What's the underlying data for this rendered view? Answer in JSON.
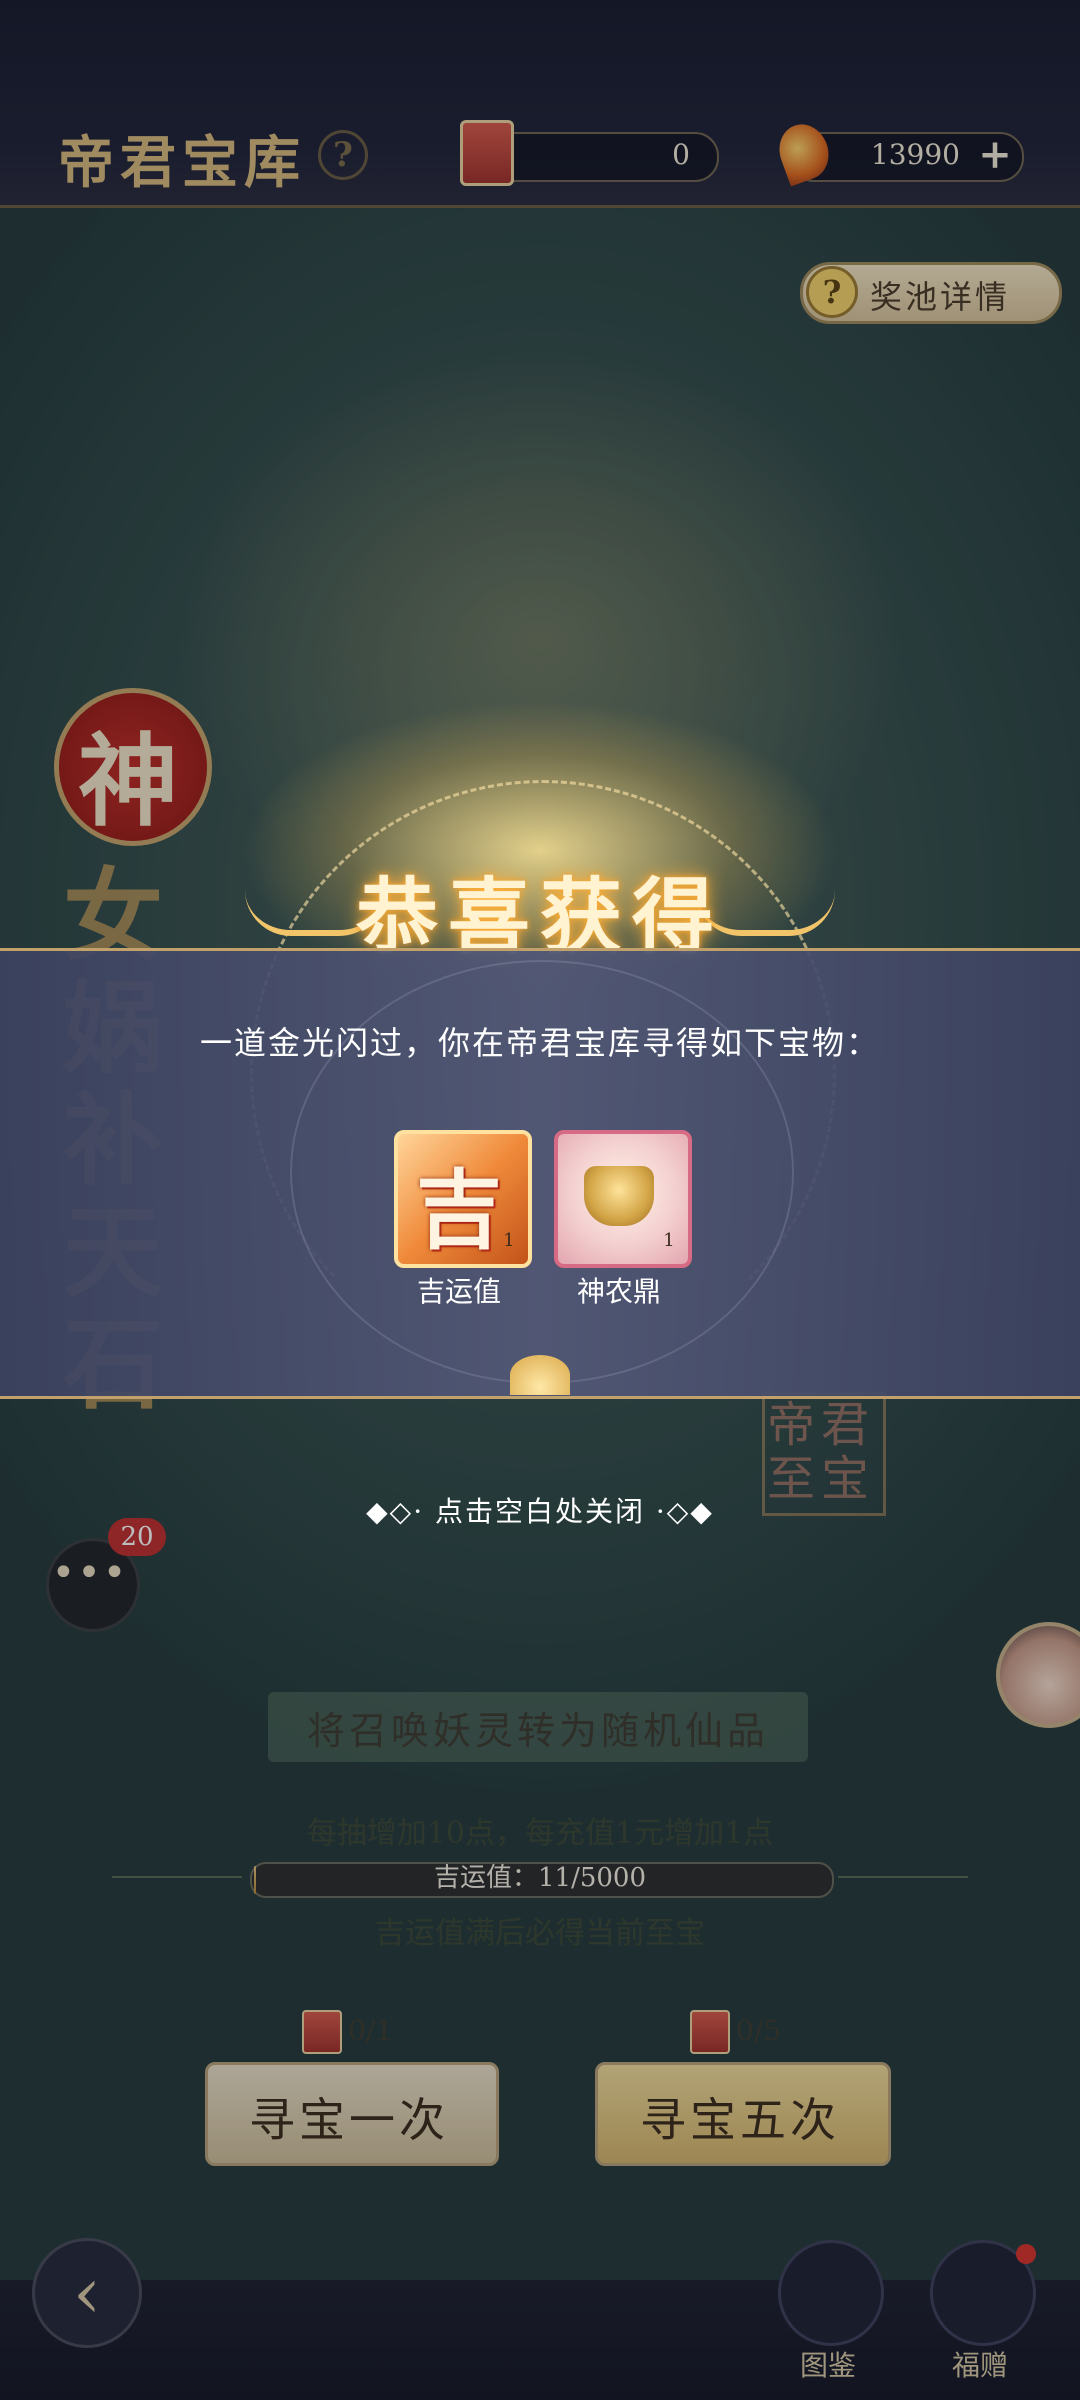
{
  "header": {
    "title": "帝君宝库",
    "help_glyph": "?",
    "currency_ticket": {
      "value": "0"
    },
    "currency_gem": {
      "value": "13990",
      "add_glyph": "+"
    }
  },
  "prize_pool": {
    "help_glyph": "?",
    "label": "奖池详情"
  },
  "side_banner": {
    "seal_char": "神",
    "vertical_title": "女娲补天石"
  },
  "seal": {
    "text": "帝君至宝"
  },
  "chat": {
    "glyph": "•••",
    "badge": "20"
  },
  "info": {
    "title": "将召唤妖灵转为随机仙品",
    "line1": "每抽增加10点，每充值1元增加1点",
    "luck_label": "吉运值：11/5000",
    "luck_progress": 0.0022,
    "note": "吉运值满后必得当前至宝"
  },
  "draw": {
    "once": {
      "cost": "0/1",
      "label": "寻宝一次"
    },
    "five": {
      "cost": "0/5",
      "label": "寻宝五次"
    }
  },
  "bottom_nav": {
    "back_glyph": "‹",
    "items": [
      {
        "label": "图鉴"
      },
      {
        "label": "福赠"
      }
    ]
  },
  "reward_popup": {
    "title": "恭喜获得",
    "message": "一道金光闪过，你在帝君宝库寻得如下宝物：",
    "items": [
      {
        "glyph": "吉",
        "name": "吉运值",
        "count": "1"
      },
      {
        "name": "神农鼎",
        "count": "1"
      }
    ],
    "close_hint": "◆◇· 点击空白处关闭 ·◇◆"
  },
  "colors": {
    "accent_gold": "#d8b97c",
    "panel": "#4a5070",
    "badge_red": "#c02d2d"
  }
}
